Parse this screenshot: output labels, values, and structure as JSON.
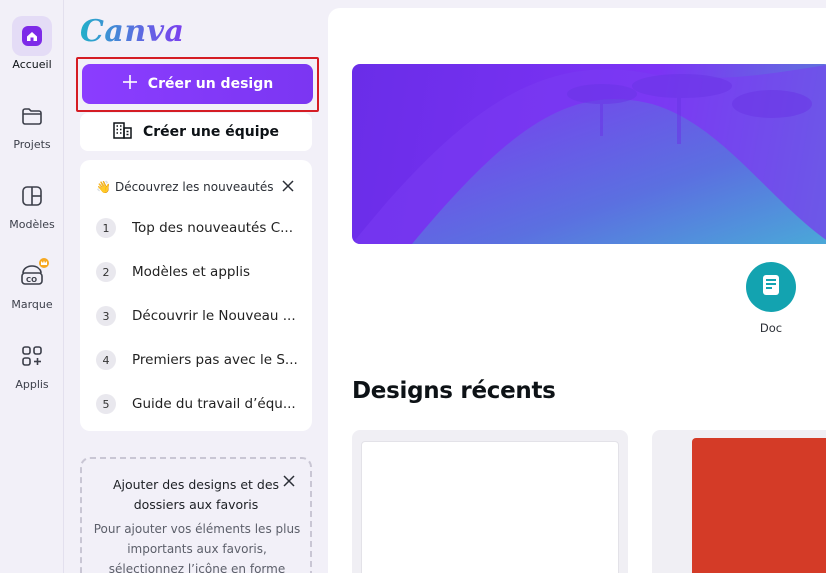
{
  "rail": {
    "items": [
      {
        "label": "Accueil",
        "icon": "home-icon",
        "active": true
      },
      {
        "label": "Projets",
        "icon": "folder-icon"
      },
      {
        "label": "Modèles",
        "icon": "templates-icon"
      },
      {
        "label": "Marque",
        "icon": "brand-icon",
        "badge": "crown-icon"
      },
      {
        "label": "Applis",
        "icon": "apps-icon"
      }
    ]
  },
  "panel": {
    "logo": "Canva",
    "create_label": "Créer un design",
    "team_label": "Créer une équipe",
    "news": {
      "heading": "Découvrez les nouveautés",
      "items": [
        {
          "num": "1",
          "text": "Top des nouveautés C..."
        },
        {
          "num": "2",
          "text": "Modèles et applis"
        },
        {
          "num": "3",
          "text": "Découvrir le Nouveau ..."
        },
        {
          "num": "4",
          "text": "Premiers pas avec le S..."
        },
        {
          "num": "5",
          "text": "Guide du travail d’équ..."
        }
      ]
    },
    "favorites": {
      "title": "Ajouter des designs et des dossiers aux favoris",
      "body": "Pour ajouter vos éléments les plus importants aux favoris, sélectionnez l’icône en forme d’étoile ⭐ sur un"
    }
  },
  "main": {
    "doc_label": "Doc",
    "recent_title": "Designs récents"
  },
  "colors": {
    "accent": "#8b3dff",
    "highlight_border": "#d51c24",
    "doc_teal": "#13a3b0",
    "thumb_red": "#d43b27"
  }
}
